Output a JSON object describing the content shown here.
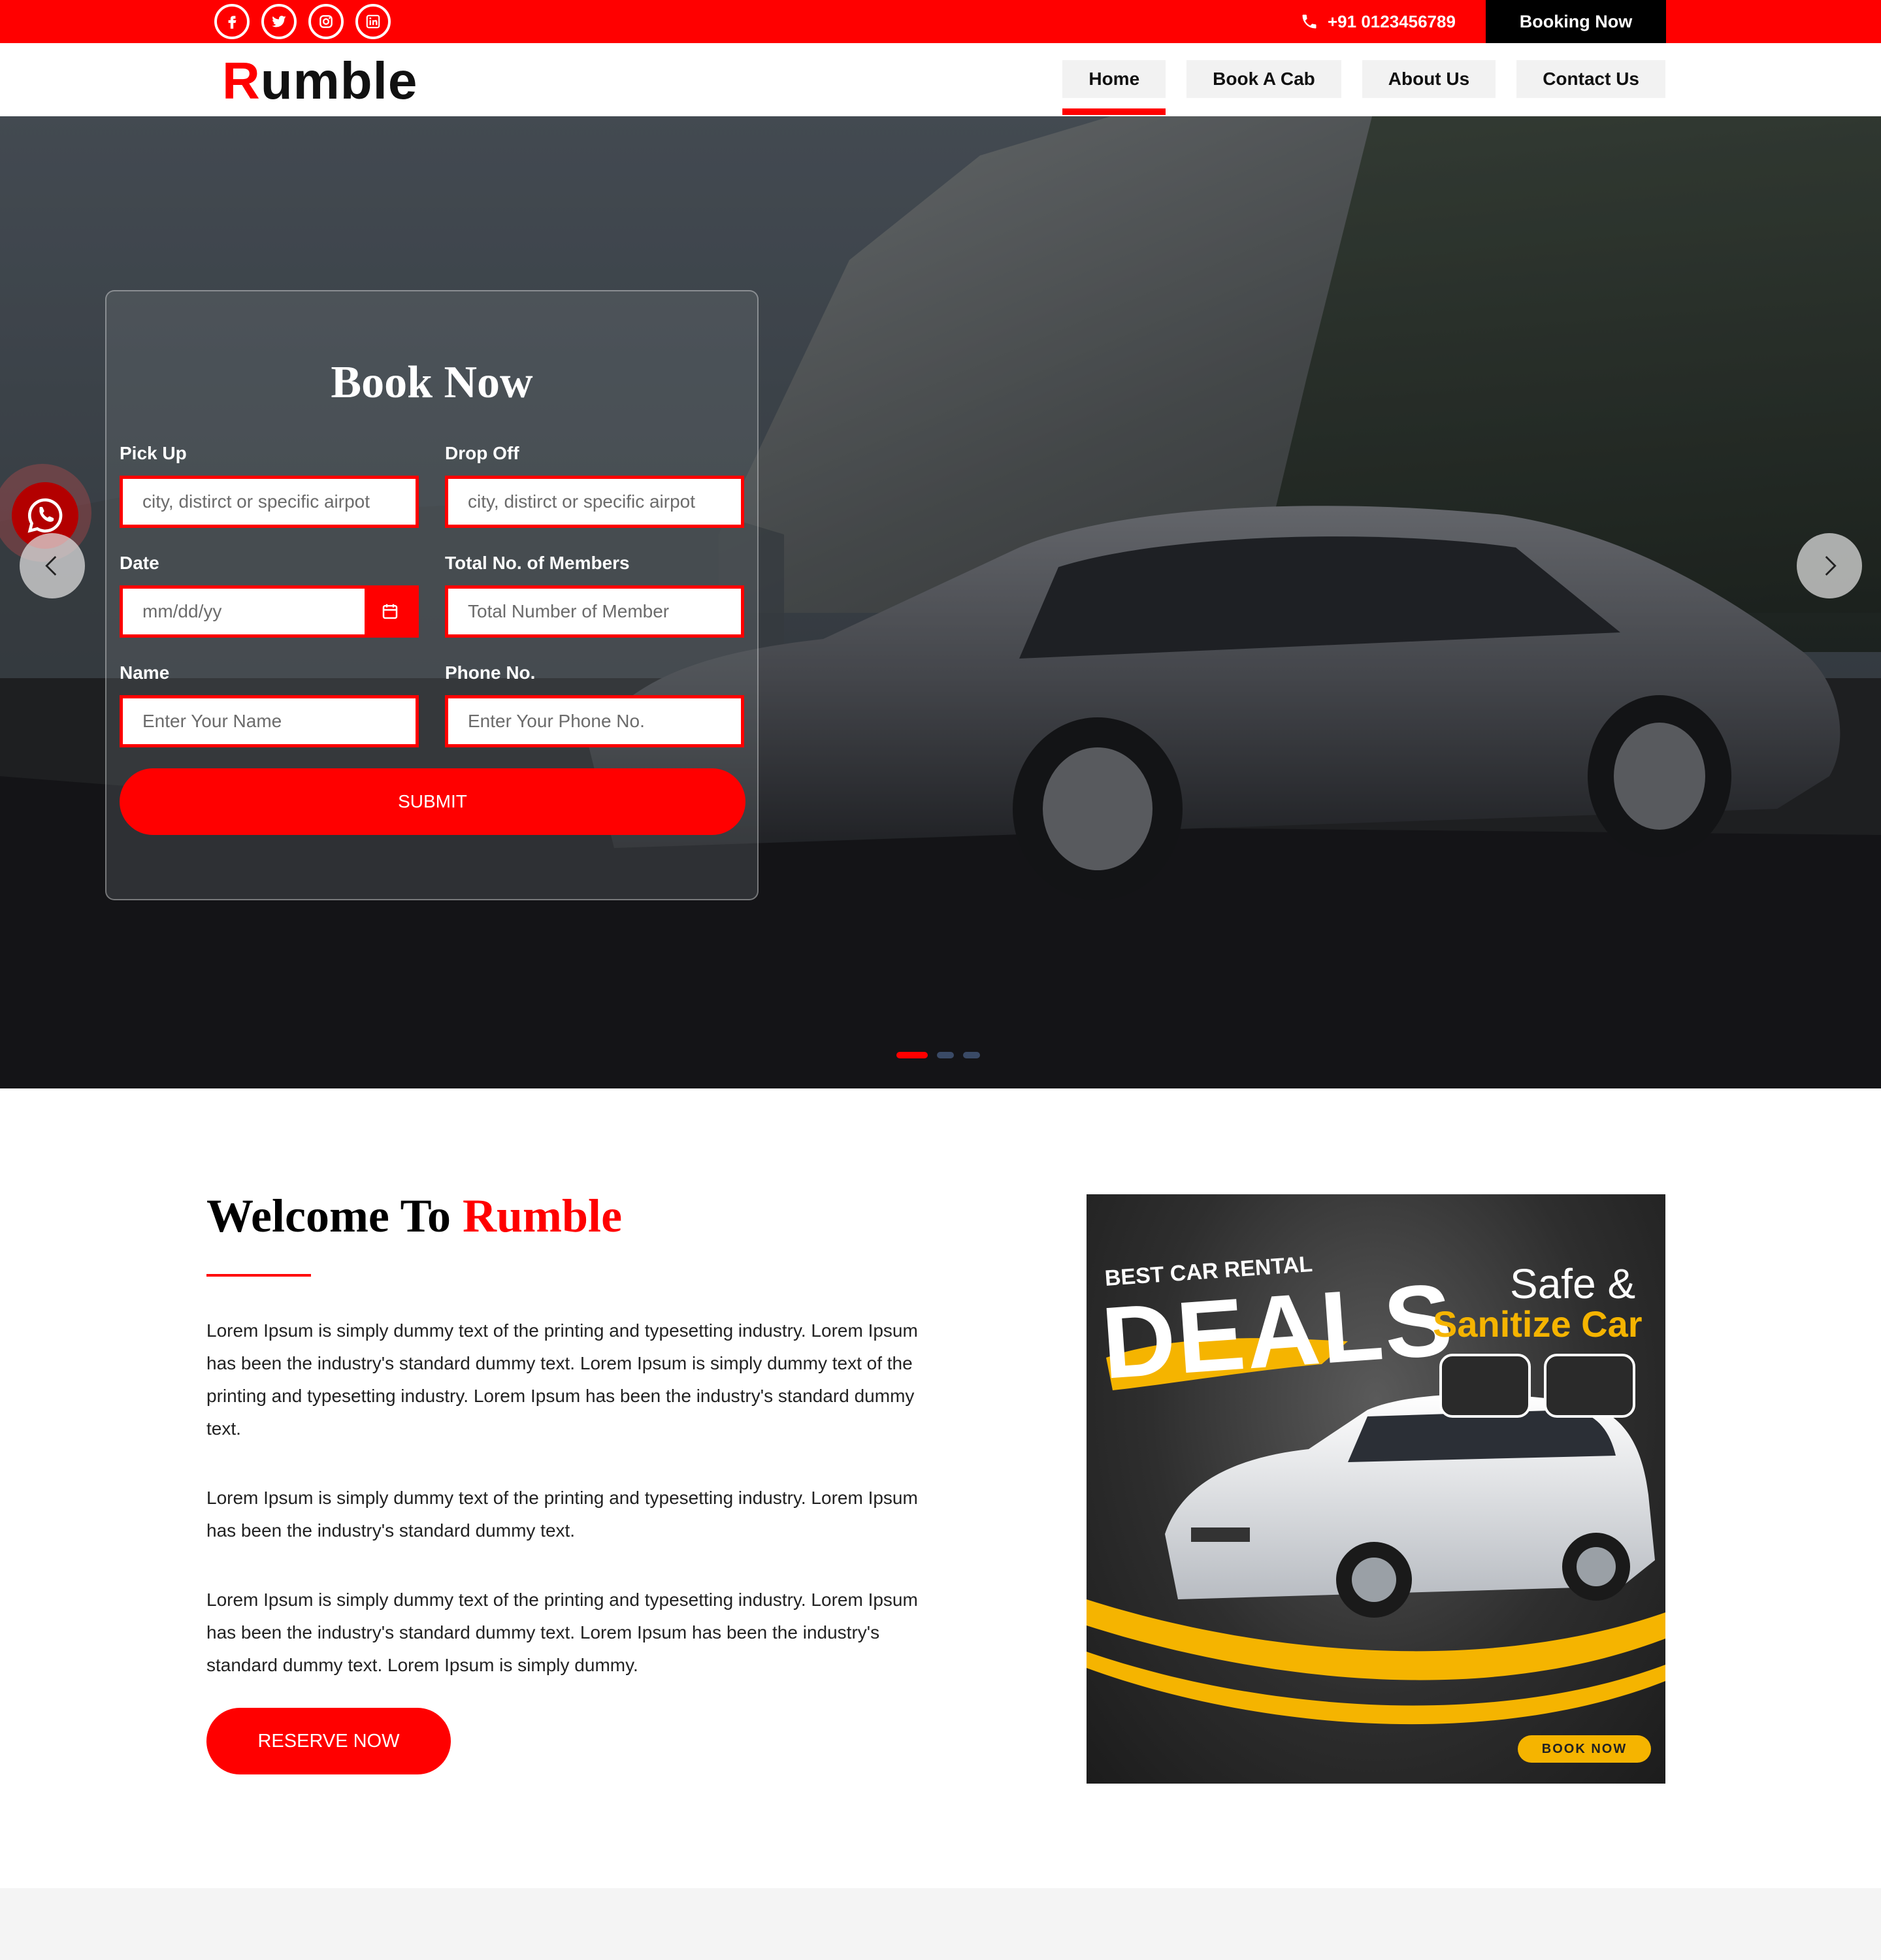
{
  "topbar": {
    "social_icons": [
      "facebook-icon",
      "twitter-icon",
      "instagram-icon",
      "linkedin-icon"
    ],
    "phone": "+91 0123456789",
    "booking_button": "Booking Now"
  },
  "header": {
    "logo_initial": "R",
    "logo_rest": "umble",
    "nav": [
      {
        "label": "Home",
        "active": true
      },
      {
        "label": "Book A Cab",
        "active": false
      },
      {
        "label": "About Us",
        "active": false
      },
      {
        "label": "Contact Us",
        "active": false
      }
    ]
  },
  "hero": {
    "panel_title": "Book Now",
    "fields": {
      "pickup": {
        "label": "Pick Up",
        "placeholder": "city, distirct or specific airpot"
      },
      "dropoff": {
        "label": "Drop Off",
        "placeholder": "city, distirct or specific airpot"
      },
      "date": {
        "label": "Date",
        "placeholder": "mm/dd/yy"
      },
      "members": {
        "label": "Total No. of Members",
        "placeholder": "Total Number of Member"
      },
      "name": {
        "label": "Name",
        "placeholder": "Enter Your Name"
      },
      "phone": {
        "label": "Phone No.",
        "placeholder": "Enter Your Phone No."
      }
    },
    "submit_label": "SUBMIT",
    "slides_total": 3,
    "active_slide": 1
  },
  "welcome": {
    "title_prefix": "Welcome To ",
    "title_accent": "Rumble",
    "paragraphs": [
      "Lorem Ipsum is simply dummy text of the printing and typesetting industry. Lorem Ipsum has been the industry's standard dummy text. Lorem Ipsum is simply dummy text of the printing and typesetting industry. Lorem Ipsum has been the industry's standard dummy text.",
      "Lorem Ipsum is simply dummy text of the printing and typesetting industry. Lorem Ipsum has been the industry's standard dummy text.",
      "Lorem Ipsum is simply dummy text of the printing and typesetting industry. Lorem Ipsum has been the industry's standard dummy text. Lorem Ipsum has been the industry's standard dummy text. Lorem Ipsum is simply dummy."
    ],
    "reserve_label": "RESERVE NOW"
  },
  "promo": {
    "line1": "BEST CAR RENTAL",
    "line2": "DEALS",
    "line3": "Safe &",
    "line4": "Sanitize Car",
    "book_label": "BOOK NOW"
  },
  "colors": {
    "accent": "#ff0000",
    "dark": "#000000",
    "promo_yellow": "#f5b400"
  }
}
